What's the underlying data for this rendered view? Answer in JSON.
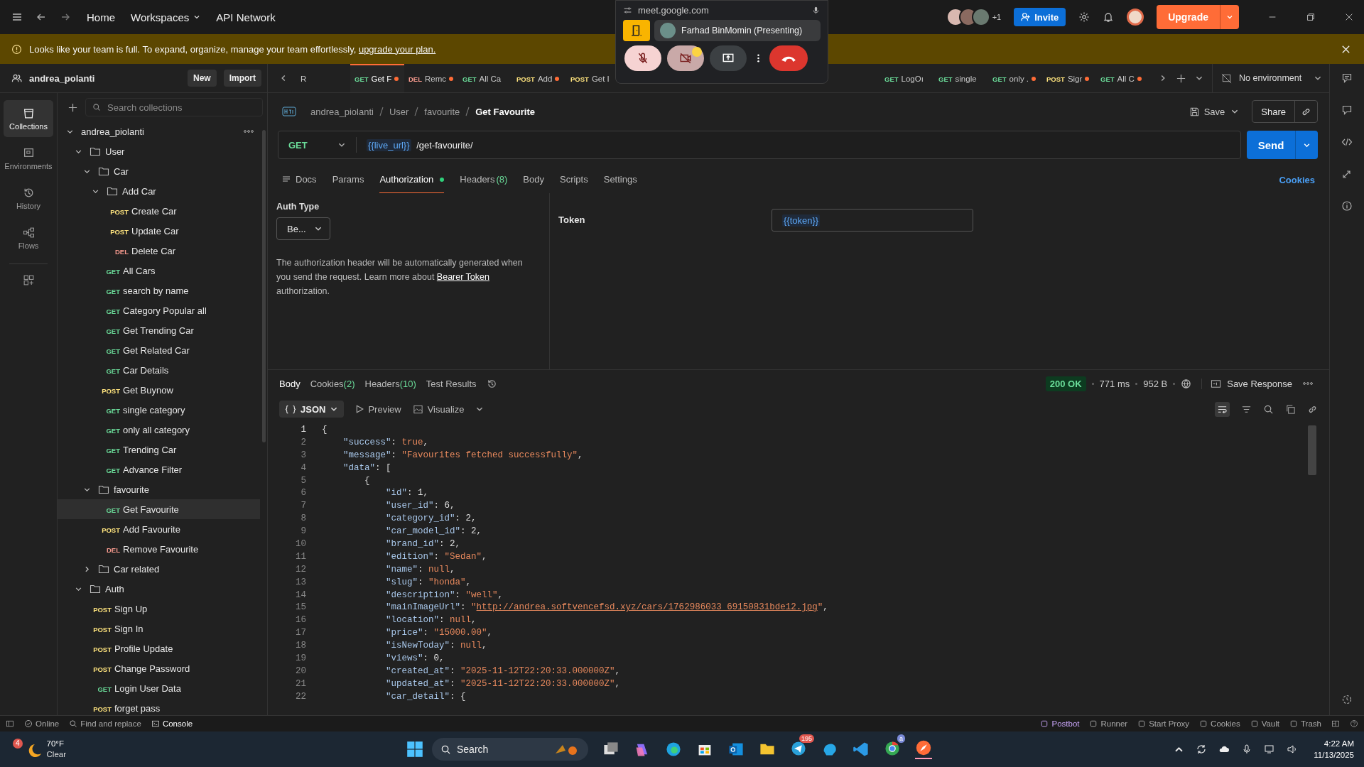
{
  "topbar": {
    "nav": [
      {
        "label": "Home",
        "dropdown": false
      },
      {
        "label": "Workspaces",
        "dropdown": true
      },
      {
        "label": "API Network",
        "dropdown": false
      }
    ],
    "avatar_more": "+1",
    "invite": "Invite",
    "upgrade": "Upgrade"
  },
  "meet_overlay": {
    "url": "meet.google.com",
    "presenter": "Farhad BinMomin (Presenting)"
  },
  "banner": {
    "text": "Looks like your team is full. To expand, organize, manage your team effortlessly, ",
    "link": "upgrade your plan."
  },
  "workspace": {
    "name": "andrea_polanti",
    "buttons": [
      "New",
      "Import"
    ]
  },
  "rail": [
    {
      "label": "Collections",
      "selected": true
    },
    {
      "label": "Environments",
      "selected": false
    },
    {
      "label": "History",
      "selected": false
    },
    {
      "label": "Flows",
      "selected": false
    }
  ],
  "search": {
    "placeholder": "Search collections"
  },
  "tree": [
    {
      "kind": "folder",
      "name": "andrea_piolanti",
      "expanded": true,
      "selected": false,
      "children": [
        {
          "kind": "folder",
          "name": "User",
          "expanded": true,
          "selected": false,
          "children": [
            {
              "kind": "folder",
              "name": "Car",
              "expanded": true,
              "selected": false,
              "children": [
                {
                  "kind": "folder",
                  "name": "Add Car",
                  "expanded": true,
                  "selected": false,
                  "children": [
                    {
                      "kind": "request",
                      "method": "POST",
                      "name": "Create Car",
                      "selected": false
                    },
                    {
                      "kind": "request",
                      "method": "POST",
                      "name": "Update Car",
                      "selected": false
                    },
                    {
                      "kind": "request",
                      "method": "DEL",
                      "name": "Delete Car",
                      "selected": false
                    }
                  ]
                },
                {
                  "kind": "request",
                  "method": "GET",
                  "name": "All Cars",
                  "selected": false
                },
                {
                  "kind": "request",
                  "method": "GET",
                  "name": "search by name",
                  "selected": false
                },
                {
                  "kind": "request",
                  "method": "GET",
                  "name": "Category Popular all",
                  "selected": false
                },
                {
                  "kind": "request",
                  "method": "GET",
                  "name": "Get Trending Car",
                  "selected": false
                },
                {
                  "kind": "request",
                  "method": "GET",
                  "name": "Get Related Car",
                  "selected": false
                },
                {
                  "kind": "request",
                  "method": "GET",
                  "name": "Car Details",
                  "selected": false
                },
                {
                  "kind": "request",
                  "method": "POST",
                  "name": "Get Buynow",
                  "selected": false
                },
                {
                  "kind": "request",
                  "method": "GET",
                  "name": "single category",
                  "selected": false
                },
                {
                  "kind": "request",
                  "method": "GET",
                  "name": "only all category",
                  "selected": false
                },
                {
                  "kind": "request",
                  "method": "GET",
                  "name": "Trending Car",
                  "selected": false
                },
                {
                  "kind": "request",
                  "method": "GET",
                  "name": "Advance Filter",
                  "selected": false
                }
              ]
            },
            {
              "kind": "folder",
              "name": "favourite",
              "expanded": true,
              "selected": false,
              "children": [
                {
                  "kind": "request",
                  "method": "GET",
                  "name": "Get Favourite",
                  "selected": true
                },
                {
                  "kind": "request",
                  "method": "POST",
                  "name": "Add Favourite",
                  "selected": false
                },
                {
                  "kind": "request",
                  "method": "DEL",
                  "name": "Remove Favourite",
                  "selected": false
                }
              ]
            },
            {
              "kind": "folder",
              "name": "Car related",
              "expanded": false,
              "selected": false
            }
          ]
        },
        {
          "kind": "folder",
          "name": "Auth",
          "expanded": true,
          "selected": false,
          "children": [
            {
              "kind": "request",
              "method": "POST",
              "name": "Sign Up",
              "selected": false
            },
            {
              "kind": "request",
              "method": "POST",
              "name": "Sign In",
              "selected": false
            },
            {
              "kind": "request",
              "method": "POST",
              "name": "Profile Update",
              "selected": false
            },
            {
              "kind": "request",
              "method": "POST",
              "name": "Change Password",
              "selected": false
            },
            {
              "kind": "request",
              "method": "GET",
              "name": "Login User Data",
              "selected": false
            },
            {
              "kind": "request",
              "method": "POST",
              "name": "forget pass",
              "selected": false
            }
          ]
        }
      ]
    }
  ],
  "tab_groups": [
    [
      {
        "name": "R",
        "selected": false,
        "unsaved": false
      },
      {
        "method": "GET",
        "name": "Get F",
        "selected": true,
        "unsaved": true
      },
      {
        "method": "DEL",
        "name": "Remc",
        "selected": false,
        "unsaved": true
      },
      {
        "method": "GET",
        "name": "All Ca",
        "selected": false,
        "unsaved": false
      },
      {
        "method": "POST",
        "name": "Add",
        "selected": false,
        "unsaved": true
      },
      {
        "method": "POST",
        "name": "Get I",
        "selected": false,
        "unsaved": false
      }
    ],
    [
      {
        "method": "GET",
        "name": "LogOı",
        "selected": false,
        "unsaved": false
      },
      {
        "method": "GET",
        "name": "single",
        "selected": false,
        "unsaved": false
      },
      {
        "method": "GET",
        "name": "only .",
        "selected": false,
        "unsaved": true
      },
      {
        "method": "POST",
        "name": "Sigr",
        "selected": false,
        "unsaved": true
      },
      {
        "method": "GET",
        "name": "All C",
        "selected": false,
        "unsaved": true
      }
    ]
  ],
  "environment": "No environment",
  "breadcrumb": [
    "andrea_piolanti",
    "User",
    "favourite",
    "Get Favourite"
  ],
  "save": "Save",
  "share": "Share",
  "request": {
    "method": "GET",
    "url_var": "{{live_url}}",
    "url_path": "/get-favourite/",
    "send": "Send"
  },
  "request_tabs": [
    {
      "label": "Docs",
      "dot": false,
      "selected": false
    },
    {
      "label": "Params",
      "dot": false,
      "selected": false
    },
    {
      "label": "Authorization",
      "dot": true,
      "selected": true
    },
    {
      "label": "Headers",
      "count": "(8)",
      "dot": false,
      "selected": false
    },
    {
      "label": "Body",
      "dot": false,
      "selected": false
    },
    {
      "label": "Scripts",
      "dot": false,
      "selected": false
    },
    {
      "label": "Settings",
      "dot": false,
      "selected": false
    }
  ],
  "cookies_link": "Cookies",
  "auth": {
    "type_label": "Auth Type",
    "type_value": "Be...",
    "description": "The authorization header will be automatically generated when you send the request. Learn more about ",
    "link": "Bearer Token",
    "description_end": " authorization.",
    "token_label": "Token",
    "token_value": "{{token}}"
  },
  "response_tabs": [
    {
      "label": "Body",
      "selected": true
    },
    {
      "label": "Cookies",
      "count": "(2)",
      "selected": false
    },
    {
      "label": "Headers",
      "count": "(10)",
      "selected": false
    },
    {
      "label": "Test Results",
      "selected": false
    }
  ],
  "response_meta": {
    "status": "200 OK",
    "time": "771 ms",
    "size": "952 B",
    "save": "Save Response"
  },
  "format": {
    "type": "JSON",
    "preview": "Preview",
    "visualize": "Visualize"
  },
  "code_lines": [
    {
      "n": "1",
      "text": "{"
    },
    {
      "n": "2",
      "text": "    \"success\": true,"
    },
    {
      "n": "3",
      "text": "    \"message\": \"Favourites fetched successfully\","
    },
    {
      "n": "4",
      "text": "    \"data\": ["
    },
    {
      "n": "5",
      "text": "        {"
    },
    {
      "n": "6",
      "text": "            \"id\": 1,"
    },
    {
      "n": "7",
      "text": "            \"user_id\": 6,"
    },
    {
      "n": "8",
      "text": "            \"category_id\": 2,"
    },
    {
      "n": "9",
      "text": "            \"car_model_id\": 2,"
    },
    {
      "n": "10",
      "text": "            \"brand_id\": 2,"
    },
    {
      "n": "11",
      "text": "            \"edition\": \"Sedan\","
    },
    {
      "n": "12",
      "text": "            \"name\": null,"
    },
    {
      "n": "13",
      "text": "            \"slug\": \"honda\","
    },
    {
      "n": "14",
      "text": "            \"description\": \"well\","
    },
    {
      "n": "15",
      "text": "            \"mainImageUrl\": \"http://andrea.softvencefsd.xyz/cars/1762986033_69150831bde12.jpg\","
    },
    {
      "n": "16",
      "text": "            \"location\": null,"
    },
    {
      "n": "17",
      "text": "            \"price\": \"15000.00\","
    },
    {
      "n": "18",
      "text": "            \"isNewToday\": null,"
    },
    {
      "n": "19",
      "text": "            \"views\": 0,"
    },
    {
      "n": "20",
      "text": "            \"created_at\": \"2025-11-12T22:20:33.000000Z\","
    },
    {
      "n": "21",
      "text": "            \"updated_at\": \"2025-11-12T22:20:33.000000Z\","
    },
    {
      "n": "22",
      "text": "            \"car_detail\": {"
    }
  ],
  "statusbar": {
    "left": [
      "Online",
      "Find and replace",
      "Console"
    ],
    "right": [
      "Postbot",
      "Runner",
      "Start Proxy",
      "Cookies",
      "Vault",
      "Trash"
    ]
  },
  "taskbar": {
    "weather_badge": "4",
    "temp": "70°F",
    "condition": "Clear",
    "search": "Search",
    "messenger_badge": "195",
    "browser_badge": "a",
    "time": "4:22 AM",
    "date": "11/13/2025"
  }
}
